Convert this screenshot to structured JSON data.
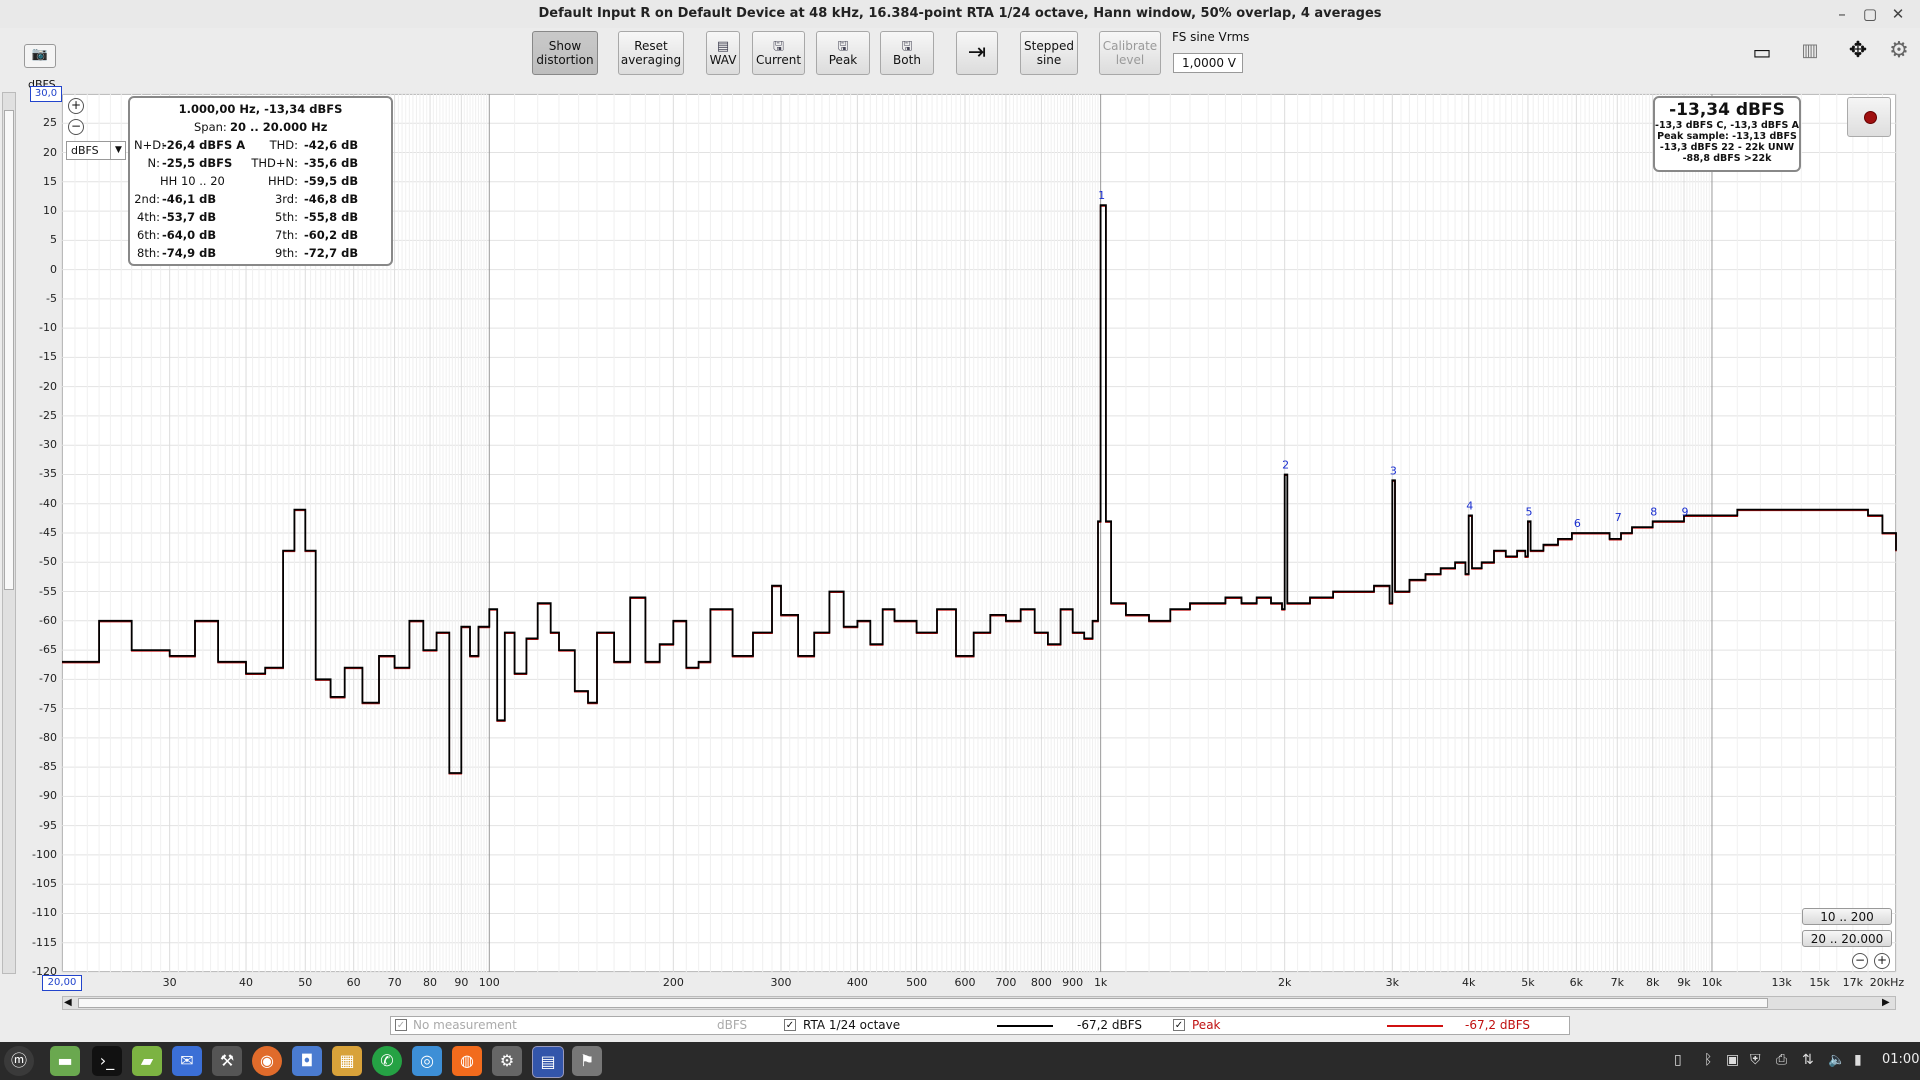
{
  "window": {
    "title": "Default Input R on Default Device at 48 kHz, 16.384-point RTA 1/24 octave, Hann window, 50% overlap, 4 averages",
    "minimize": "–",
    "maximize": "▢",
    "close": "✕"
  },
  "toolbar": {
    "show_distortion": [
      "Show",
      "distortion"
    ],
    "reset_averaging": [
      "Reset",
      "averaging"
    ],
    "wav": "WAV",
    "current": "Current",
    "peak": "Peak",
    "both": "Both",
    "stepped_sine": [
      "Stepped",
      "sine"
    ],
    "calibrate_level": [
      "Calibrate",
      "level"
    ],
    "fs_label": "FS sine Vrms",
    "fs_value": "1,0000 V"
  },
  "plot": {
    "unit_label": "dBFS",
    "y_top_value": "30,0",
    "x_left_value": "20,00",
    "units_select": "dBFS",
    "y_ticks": [
      "25",
      "20",
      "15",
      "10",
      "5",
      "0",
      "-5",
      "-10",
      "-15",
      "-20",
      "-25",
      "-30",
      "-35",
      "-40",
      "-45",
      "-50",
      "-55",
      "-60",
      "-65",
      "-70",
      "-75",
      "-80",
      "-85",
      "-90",
      "-95",
      "-100",
      "-105",
      "-110",
      "-115",
      "-120"
    ],
    "x_ticks": [
      "30",
      "40",
      "50",
      "60",
      "70",
      "80",
      "90",
      "100",
      "200",
      "300",
      "400",
      "500",
      "600",
      "700",
      "800",
      "900",
      "1k",
      "2k",
      "3k",
      "4k",
      "5k",
      "6k",
      "7k",
      "8k",
      "9k",
      "10k",
      "13k",
      "15k",
      "17k",
      "20kHz"
    ]
  },
  "info": {
    "line1": "1.000,00 Hz, -13,34 dBFS",
    "span_label": "Span:",
    "span_value": "20 .. 20.000 Hz",
    "rows": [
      {
        "l_label": "N+D:",
        "l_value": "-26,4 dBFS A",
        "r_label": "THD:",
        "r_value": "-42,6 dB"
      },
      {
        "l_label": "N:",
        "l_value": "-25,5 dBFS",
        "r_label": "THD+N:",
        "r_value": "-35,6 dB"
      },
      {
        "l_label": "HH 10 .. 20",
        "l_value": "",
        "r_label": "HHD:",
        "r_value": "-59,5 dB"
      },
      {
        "l_label": "2nd:",
        "l_value": "-46,1 dB",
        "r_label": "3rd:",
        "r_value": "-46,8 dB"
      },
      {
        "l_label": "4th:",
        "l_value": "-53,7 dB",
        "r_label": "5th:",
        "r_value": "-55,8 dB"
      },
      {
        "l_label": "6th:",
        "l_value": "-64,0 dB",
        "r_label": "7th:",
        "r_value": "-60,2 dB"
      },
      {
        "l_label": "8th:",
        "l_value": "-74,9 dB",
        "r_label": "9th:",
        "r_value": "-72,7 dB"
      }
    ]
  },
  "level": {
    "main": "-13,34 dBFS",
    "l1": "-13,3 dBFS C, -13,3 dBFS A",
    "l2": "Peak sample: -13,13 dBFS",
    "l3": "-13,3 dBFS 22 - 22k UNW",
    "l4": "-88,8 dBFS >22k"
  },
  "range_buttons": [
    "10 .. 200",
    "20 .. 20.000"
  ],
  "legend": {
    "no_measurement": "No measurement",
    "no_meas_unit": "dBFS",
    "rta_label": "RTA 1/24 octave",
    "rta_value": "-67,2 dBFS",
    "peak_label": "Peak",
    "peak_value": "-67,2 dBFS"
  },
  "harmonic_labels": [
    "1",
    "2",
    "3",
    "4",
    "5",
    "6",
    "7",
    "8",
    "9"
  ],
  "taskbar": {
    "clock": "01:00"
  },
  "chart_data": {
    "type": "line",
    "title": "",
    "xlabel": "",
    "ylabel": "dBFS",
    "x_scale": "log",
    "xlim": [
      20,
      20000
    ],
    "ylim": [
      -120,
      30
    ],
    "grid": true,
    "series": [
      {
        "name": "RTA 1/24 octave",
        "color": "#000000",
        "x": [
          20,
          23,
          26,
          30,
          33,
          36,
          40,
          43,
          46,
          48,
          50,
          52,
          55,
          58,
          62,
          66,
          70,
          74,
          78,
          82,
          86,
          90,
          93,
          96,
          100,
          103,
          106,
          110,
          115,
          120,
          126,
          130,
          138,
          145,
          150,
          160,
          170,
          180,
          190,
          200,
          210,
          220,
          230,
          250,
          270,
          290,
          300,
          320,
          340,
          360,
          380,
          400,
          420,
          440,
          460,
          500,
          540,
          580,
          620,
          660,
          700,
          740,
          780,
          820,
          860,
          900,
          940,
          970,
          990,
          1000,
          1020,
          1040,
          1100,
          1200,
          1300,
          1400,
          1500,
          1600,
          1700,
          1800,
          1900,
          1980,
          2000,
          2020,
          2200,
          2400,
          2600,
          2800,
          2970,
          3000,
          3030,
          3200,
          3400,
          3600,
          3800,
          3950,
          4000,
          4050,
          4200,
          4400,
          4600,
          4800,
          4950,
          5000,
          5050,
          5300,
          5600,
          5900,
          6200,
          6500,
          6800,
          7100,
          7400,
          7700,
          8000,
          8500,
          9000,
          9500,
          10000,
          11000,
          12000,
          13000,
          14000,
          15000,
          16000,
          17000,
          18000,
          19000,
          20000
        ],
        "y": [
          -67,
          -60,
          -65,
          -66,
          -60,
          -67,
          -69,
          -68,
          -48,
          -41,
          -48,
          -70,
          -73,
          -68,
          -74,
          -66,
          -68,
          -60,
          -65,
          -62,
          -86,
          -61,
          -66,
          -61,
          -58,
          -77,
          -62,
          -69,
          -63,
          -57,
          -62,
          -65,
          -72,
          -74,
          -62,
          -67,
          -56,
          -67,
          -64,
          -60,
          -68,
          -67,
          -58,
          -66,
          -62,
          -54,
          -59,
          -66,
          -62,
          -55,
          -61,
          -60,
          -64,
          -58,
          -60,
          -62,
          -58,
          -66,
          -62,
          -59,
          -60,
          -58,
          -62,
          -64,
          -58,
          -62,
          -63,
          -60,
          -43,
          11,
          -43,
          -57,
          -59,
          -60,
          -58,
          -57,
          -57,
          -56,
          -57,
          -56,
          -57,
          -58,
          -35,
          -57,
          -56,
          -55,
          -55,
          -54,
          -57,
          -36,
          -55,
          -53,
          -52,
          -51,
          -50,
          -52,
          -42,
          -51,
          -50,
          -48,
          -49,
          -48,
          -49,
          -43,
          -48,
          -47,
          -46,
          -45,
          -45,
          -45,
          -46,
          -45,
          -44,
          -44,
          -43,
          -43,
          -42,
          -42,
          -42,
          -41,
          -41,
          -41,
          -41,
          -41,
          -41,
          -41,
          -42,
          -45,
          -48
        ]
      }
    ],
    "harmonics": [
      {
        "label": "1",
        "freq": 1000,
        "level": 11
      },
      {
        "label": "2",
        "freq": 2000,
        "level": -35
      },
      {
        "label": "3",
        "freq": 3000,
        "level": -36
      },
      {
        "label": "4",
        "freq": 4000,
        "level": -42
      },
      {
        "label": "5",
        "freq": 5000,
        "level": -43
      },
      {
        "label": "6",
        "freq": 6000,
        "level": -45
      },
      {
        "label": "7",
        "freq": 7000,
        "level": -44
      },
      {
        "label": "8",
        "freq": 8000,
        "level": -43
      },
      {
        "label": "9",
        "freq": 9000,
        "level": -43
      }
    ]
  }
}
